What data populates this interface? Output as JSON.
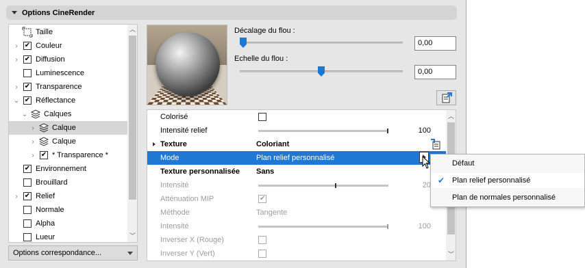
{
  "panel": {
    "title": "Options CineRender",
    "options_button": "Options correspondance..."
  },
  "tree": [
    {
      "label": "Taille",
      "indent": 0,
      "chevron": false,
      "checkbox": "none",
      "icon": "size-icon"
    },
    {
      "label": "Couleur",
      "indent": 0,
      "chevron": true,
      "checkbox": "checked"
    },
    {
      "label": "Diffusion",
      "indent": 0,
      "chevron": true,
      "checkbox": "checked"
    },
    {
      "label": "Luminescence",
      "indent": 0,
      "chevron": false,
      "checkbox": "unchecked"
    },
    {
      "label": "Transparence",
      "indent": 0,
      "chevron": true,
      "checkbox": "checked"
    },
    {
      "label": "Réflectance",
      "indent": 0,
      "chevron": "open",
      "checkbox": "checked"
    },
    {
      "label": "Calques",
      "indent": 1,
      "chevron": "open",
      "checkbox": "none",
      "icon": "layers-icon"
    },
    {
      "label": "Calque",
      "indent": 2,
      "chevron": true,
      "checkbox": "none",
      "icon": "layer-icon",
      "selected": true
    },
    {
      "label": "Calque",
      "indent": 2,
      "chevron": true,
      "checkbox": "none",
      "icon": "layer-icon"
    },
    {
      "label": "* Transparence *",
      "indent": 2,
      "chevron": true,
      "checkbox": "checked"
    },
    {
      "label": "Environnement",
      "indent": 0,
      "chevron": false,
      "checkbox": "checked"
    },
    {
      "label": "Brouillard",
      "indent": 0,
      "chevron": false,
      "checkbox": "unchecked"
    },
    {
      "label": "Relief",
      "indent": 0,
      "chevron": true,
      "checkbox": "checked"
    },
    {
      "label": "Normale",
      "indent": 0,
      "chevron": false,
      "checkbox": "unchecked"
    },
    {
      "label": "Alpha",
      "indent": 0,
      "chevron": false,
      "checkbox": "unchecked"
    },
    {
      "label": "Lueur",
      "indent": 0,
      "chevron": false,
      "checkbox": "unchecked"
    }
  ],
  "blur_offset": {
    "label": "Décalage du flou :",
    "value": "0,00",
    "slider": 0.0
  },
  "blur_scale": {
    "label": "Echelle du flou :",
    "value": "0,00",
    "slider": 0.5
  },
  "properties": {
    "colorise": {
      "label": "Colorisé"
    },
    "relief_intensity": {
      "label": "Intensité relief",
      "value": "100",
      "level": 1.0
    },
    "texture": {
      "label": "Texture",
      "value": "Coloriant"
    },
    "mode": {
      "label": "Mode",
      "value": "Plan relief personnalisé"
    },
    "custom_texture": {
      "label": "Texture personnalisée",
      "value": "Sans"
    },
    "intensity1": {
      "label": "Intensité",
      "value": "20",
      "level": 0.2
    },
    "mip": {
      "label": "Atténuation MIP"
    },
    "method": {
      "label": "Méthode",
      "value": "Tangente"
    },
    "intensity2": {
      "label": "Intensité",
      "value": "100",
      "level": 1.0
    },
    "invert_x": {
      "label": "Inverser X (Rouge)"
    },
    "invert_y": {
      "label": "Inverser Y (Vert)"
    }
  },
  "popup": {
    "items": [
      "Défaut",
      "Plan relief personnalisé",
      "Plan de normales personnalisé"
    ],
    "selected": "Plan relief personnalisé"
  },
  "colors": {
    "accent": "#1f78d3",
    "panel_bg": "#e6e6e6"
  }
}
